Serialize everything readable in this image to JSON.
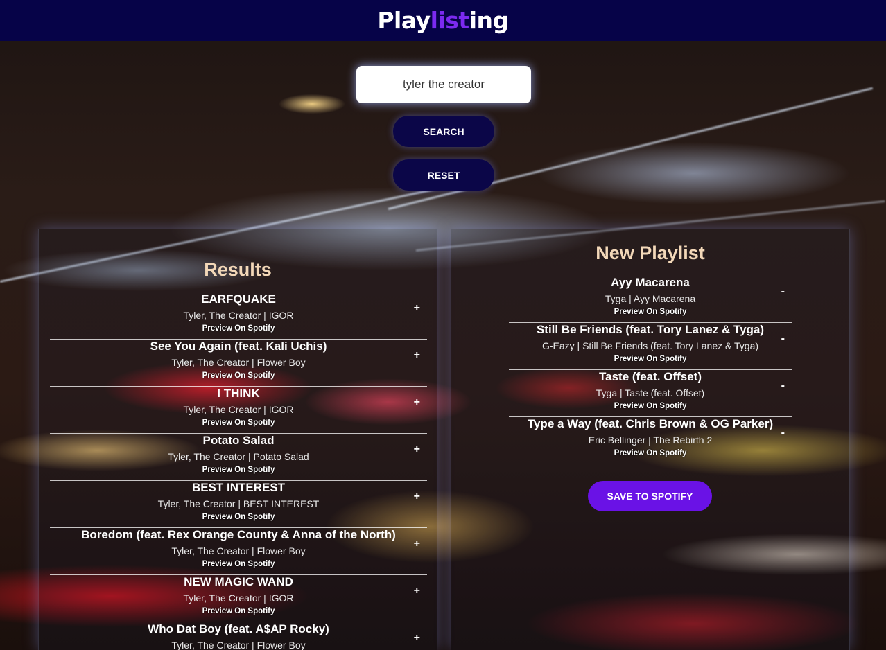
{
  "app": {
    "logo_part1": "Play",
    "logo_part2": "list",
    "logo_part3": "ing",
    "accent_color": "#7b2af0",
    "navbar_color": "#060348"
  },
  "search": {
    "value": "tyler the creator",
    "search_label": "SEARCH",
    "reset_label": "RESET"
  },
  "results": {
    "title": "Results",
    "preview_label": "Preview On Spotify",
    "action_symbol": "+",
    "tracks": [
      {
        "name": "EARFQUAKE",
        "info": "Tyler, The Creator | IGOR"
      },
      {
        "name": "See You Again (feat. Kali Uchis)",
        "info": "Tyler, The Creator | Flower Boy"
      },
      {
        "name": "I THINK",
        "info": "Tyler, The Creator | IGOR"
      },
      {
        "name": "Potato Salad",
        "info": "Tyler, The Creator | Potato Salad"
      },
      {
        "name": "BEST INTEREST",
        "info": "Tyler, The Creator | BEST INTEREST"
      },
      {
        "name": "Boredom (feat. Rex Orange County & Anna of the North)",
        "info": "Tyler, The Creator | Flower Boy"
      },
      {
        "name": "NEW MAGIC WAND",
        "info": "Tyler, The Creator | IGOR"
      },
      {
        "name": "Who Dat Boy (feat. A$AP Rocky)",
        "info": "Tyler, The Creator | Flower Boy"
      }
    ]
  },
  "playlist": {
    "title": "New Playlist",
    "preview_label": "Preview On Spotify",
    "action_symbol": "-",
    "save_label": "SAVE TO SPOTIFY",
    "tracks": [
      {
        "name": "Ayy Macarena",
        "info": "Tyga | Ayy Macarena"
      },
      {
        "name": "Still Be Friends (feat. Tory Lanez & Tyga)",
        "info": "G-Eazy | Still Be Friends (feat. Tory Lanez & Tyga)"
      },
      {
        "name": "Taste (feat. Offset)",
        "info": "Tyga | Taste (feat. Offset)"
      },
      {
        "name": "Type a Way (feat. Chris Brown & OG Parker)",
        "info": "Eric Bellinger | The Rebirth 2"
      }
    ]
  }
}
